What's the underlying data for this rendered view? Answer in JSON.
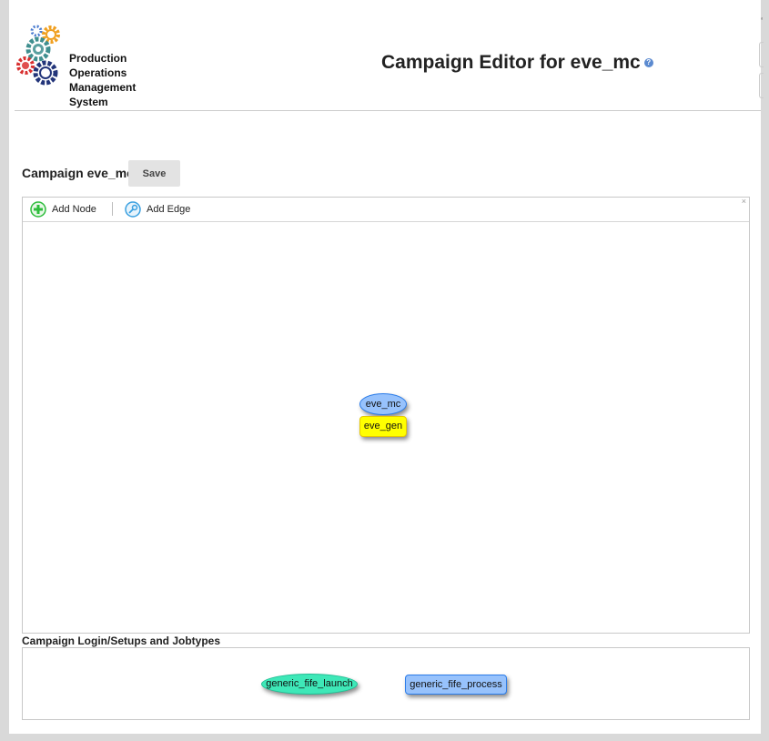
{
  "header": {
    "logo_lines": [
      "Production",
      "Operations",
      "Management",
      "System"
    ],
    "title": "Campaign Editor for eve_mc",
    "help_glyph": "?"
  },
  "campaign": {
    "label": "Campaign eve_mc",
    "save_label": "Save"
  },
  "editor": {
    "toolbar": {
      "add_node_label": "Add Node",
      "add_edge_label": "Add Edge",
      "close_glyph": "×"
    },
    "nodes": [
      {
        "label": "eve_mc",
        "shape": "ellipse",
        "color": "#97c2fc"
      },
      {
        "label": "eve_gen",
        "shape": "box",
        "color": "#ffff00"
      }
    ]
  },
  "jobtypes": {
    "section_label": "Campaign Login/Setups and Jobtypes",
    "nodes": [
      {
        "label": "generic_fife_launch",
        "shape": "ellipse",
        "color": "#3ee8b8"
      },
      {
        "label": "generic_fife_process",
        "shape": "box",
        "color": "#97c2fc"
      }
    ]
  },
  "colors": {
    "accent_blue": "#2b7ce9",
    "add_node_green": "#2ebd3c",
    "add_edge_blue": "#3aa0e0"
  },
  "icons": {
    "logo": "gears-logo-icon",
    "help": "help-icon",
    "add_node": "plus-circle-icon",
    "add_edge": "connect-icon",
    "close": "close-icon"
  }
}
